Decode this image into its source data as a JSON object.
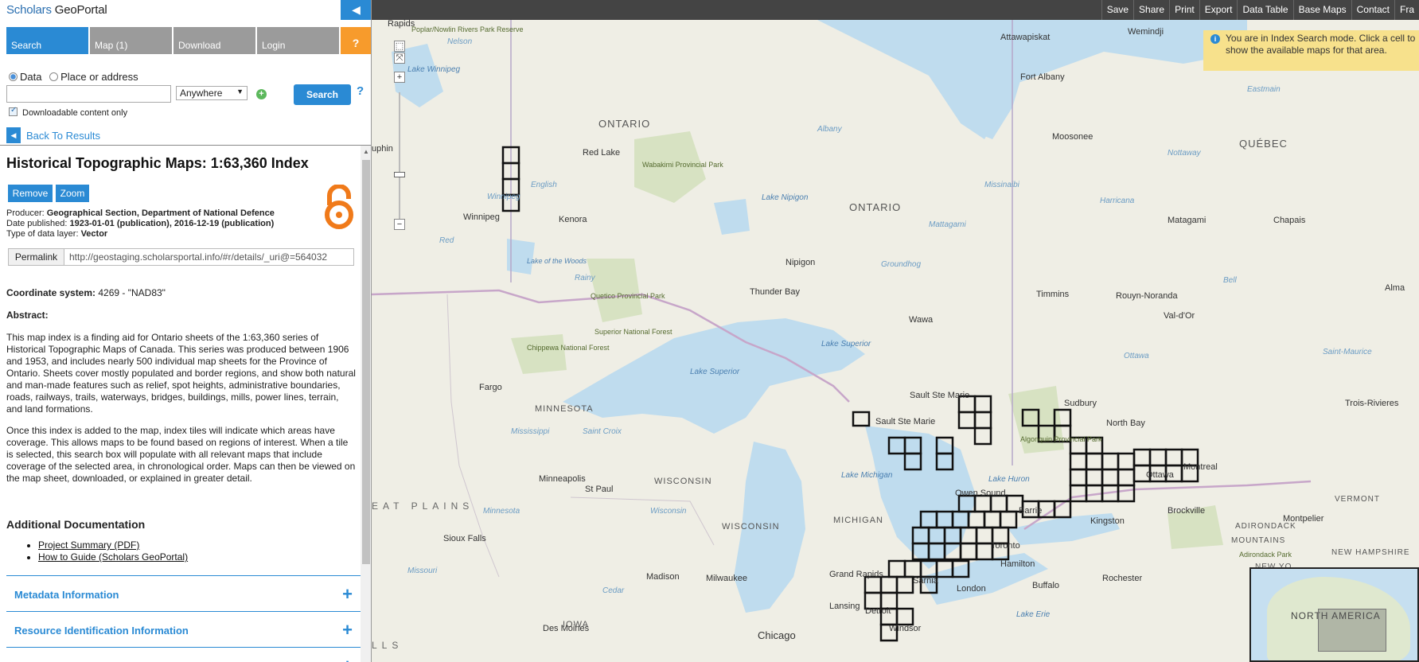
{
  "brand": {
    "part1": "Scholars ",
    "part2": "GeoPortal"
  },
  "tabs": [
    {
      "label": "Search"
    },
    {
      "label": "Map (1)"
    },
    {
      "label": "Download"
    },
    {
      "label": "Login"
    },
    {
      "label": "?"
    }
  ],
  "search": {
    "radio_data": "Data",
    "radio_place": "Place or address",
    "input_value": "",
    "location": "Anywhere",
    "search_label": "Search",
    "help": "?",
    "downloadable_label": "Downloadable content only"
  },
  "back_label": "Back To Results",
  "details": {
    "title": "Historical Topographic Maps: 1:63,360 Index",
    "remove_label": "Remove",
    "zoom_label": "Zoom",
    "producer_label": "Producer: ",
    "producer": "Geographical Section, Department of National Defence",
    "date_label": "Date published: ",
    "date": "1923-01-01 (publication), 2016-12-19 (publication)",
    "type_label": "Type of data layer: ",
    "type": "Vector",
    "permalink_label": "Permalink",
    "permalink_url": "http://geostaging.scholarsportal.info/#r/details/_uri@=564032",
    "coord_label": "Coordinate system: ",
    "coord_value": "4269 - \"NAD83\"",
    "abstract_heading": "Abstract:",
    "abstract_p1": "This map index is a finding aid for Ontario sheets of the 1:63,360 series of Historical Topographic Maps of Canada. This series was produced between 1906 and 1953, and includes nearly 500 individual map sheets for the Province of Ontario. Sheets cover mostly populated and border regions, and show both natural and man-made features such as relief, spot heights, administrative boundaries, roads, railways, trails, waterways, bridges, buildings, mills, power lines, terrain, and land formations.",
    "abstract_p2": "Once this index is added to the map, index tiles will indicate which areas have coverage. This allows maps to be found based on regions of interest. When a tile is selected, this search box will populate with all relevant maps that include coverage of the selected area, in chronological order. Maps can then be viewed on the map sheet, downloaded, or explained in greater detail.",
    "additional_doc_heading": "Additional Documentation",
    "doc_links": [
      "Project Summary (PDF)",
      "How to Guide (Scholars GeoPortal)"
    ],
    "accordions": [
      "Metadata Information",
      "Resource Identification Information",
      ""
    ]
  },
  "toolbar": [
    "Save",
    "Share",
    "Print",
    "Export",
    "Data Table",
    "Base Maps",
    "Contact",
    "Fra"
  ],
  "info_message": "You are in Index Search mode. Click a cell to show the available maps for that area.",
  "overview_label": "NORTH AMERICA",
  "map_labels": {
    "provinces": [
      "ONTARIO",
      "ONTARIO",
      "QUÉBEC",
      "MINNESOTA",
      "WISCONSIN",
      "WISCONSIN",
      "MICHIGAN",
      "IOWA",
      "VERMONT",
      "NEW HAMPSHIRE",
      "NEW YO",
      "ADIRONDACK",
      "MOUNTAINS"
    ],
    "lakes": [
      "Lake Winnipeg",
      "Lake Superior",
      "Lake Superior",
      "Lake Michigan",
      "Lake Huron",
      "Lake Nipigon",
      "Lake of the Woods",
      "Lake Erie"
    ],
    "cities": [
      "Rapids",
      "Winnipeg",
      "Kenora",
      "Red Lake",
      "Fort Albany",
      "Attawapiskat",
      "Wemindji",
      "Moosonee",
      "Nipigon",
      "Thunder Bay",
      "Wawa",
      "Timmins",
      "Rouyn-Noranda",
      "Val-d'Or",
      "Matagami",
      "Chapais",
      "Alma",
      "Trois-Rivieres",
      "Sudbury",
      "North Bay",
      "Sault Ste Marie",
      "Sault Ste Marie",
      "Fargo",
      "Minneapolis",
      "St Paul",
      "Sioux Falls",
      "Madison",
      "Milwaukee",
      "Chicago",
      "Grand Rapids",
      "Lansing",
      "Detroit",
      "Windsor",
      "Sarnia",
      "London",
      "Hamilton",
      "Toronto",
      "Barrie",
      "Owen Sound",
      "Kingston",
      "Ottawa",
      "Montreal",
      "Brockville",
      "Montpelier",
      "Buffalo",
      "Rochester",
      "Des Moines",
      "uphin",
      "Poplar/Nowlin Rivers Park Reserve",
      "Wabakimi Provincial Park",
      "Quetico Provincial Park",
      "Superior National Forest",
      "Chippewa National Forest",
      "Algonquin Provincial Park",
      "Adirondack Park"
    ],
    "rivers": [
      "Albany",
      "Nelson",
      "Missinaibi",
      "Harricana",
      "Nottaway",
      "Eastmain",
      "Bell",
      "Ottawa",
      "Saint-Maurice",
      "Mississippi",
      "Minnesota",
      "Saint Croix",
      "Red",
      "Rainy",
      "English",
      "Winnipeg",
      "Groundhog",
      "Mattagami",
      "Wisconsin",
      "Missouri",
      "Cedar"
    ],
    "region_text": "EAT PLAINS",
    "region_text2": "LLS"
  }
}
